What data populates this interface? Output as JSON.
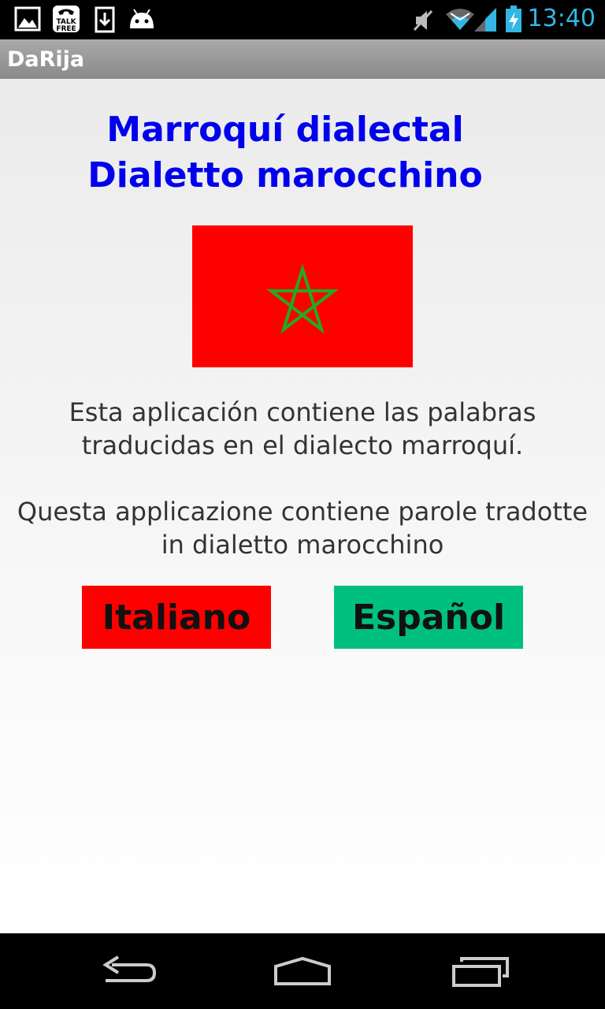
{
  "status_bar": {
    "time": "13:40",
    "left_icons": [
      "gallery-icon",
      "talkfree-icon",
      "download-icon",
      "android-icon"
    ],
    "right_icons": [
      "mute-icon",
      "wifi-icon",
      "signal-icon",
      "battery-charging-icon"
    ],
    "talkfree_text": [
      "TALK",
      "FREE"
    ]
  },
  "app_bar": {
    "title": "DaRija"
  },
  "main": {
    "heading_line1": "Marroquí dialectal",
    "heading_line2": "Dialetto marocchino",
    "flag": {
      "background": "#ff0000",
      "star_color": "#22aa22"
    },
    "spanish_line1": "Esta aplicación contiene las palabras",
    "spanish_line2": "traducidas en el dialecto marroquí.",
    "italian_line1": "Questa applicazione contiene parole tradotte",
    "italian_line2": "in dialetto marocchino",
    "buttons": {
      "italiano": "Italiano",
      "espanol": "Español"
    }
  },
  "colors": {
    "heading": "#0000ee",
    "italiano_button": "#ff0000",
    "espanol_button": "#00c080",
    "time": "#33b5e5"
  },
  "nav_bar": {
    "items": [
      "back-icon",
      "home-icon",
      "recents-icon"
    ]
  }
}
